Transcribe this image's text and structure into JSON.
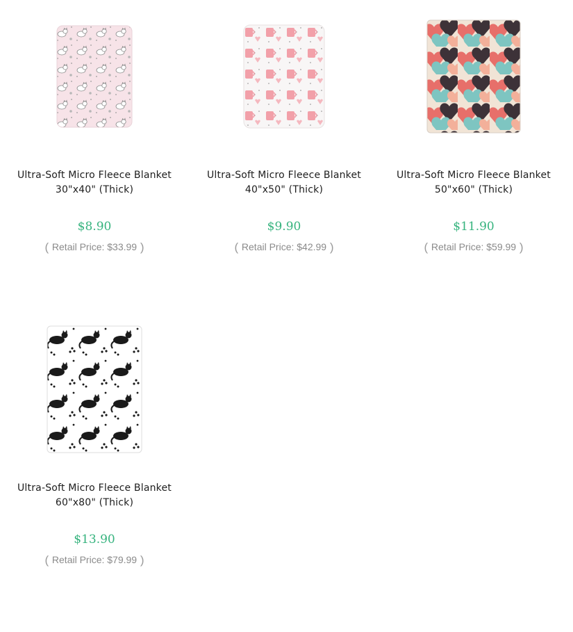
{
  "products": [
    {
      "title": "Ultra-Soft Micro Fleece Blanket 30\"x40\" (Thick)",
      "price": "$8.90",
      "retail_label": "Retail Price:",
      "retail_price": "$33.99",
      "image": "pink-cats-blanket"
    },
    {
      "title": "Ultra-Soft Micro Fleece Blanket 40\"x50\" (Thick)",
      "price": "$9.90",
      "retail_label": "Retail Price:",
      "retail_price": "$42.99",
      "image": "pink-mugs-blanket"
    },
    {
      "title": "Ultra-Soft Micro Fleece Blanket 50\"x60\" (Thick)",
      "price": "$11.90",
      "retail_label": "Retail Price:",
      "retail_price": "$59.99",
      "image": "hearts-blanket"
    },
    {
      "title": "Ultra-Soft Micro Fleece Blanket 60\"x80\" (Thick)",
      "price": "$13.90",
      "retail_label": "Retail Price:",
      "retail_price": "$79.99",
      "image": "black-cats-blanket"
    }
  ],
  "colors": {
    "price": "#36b37e",
    "retail": "#8a8a8a",
    "title": "#1d1d1d"
  }
}
